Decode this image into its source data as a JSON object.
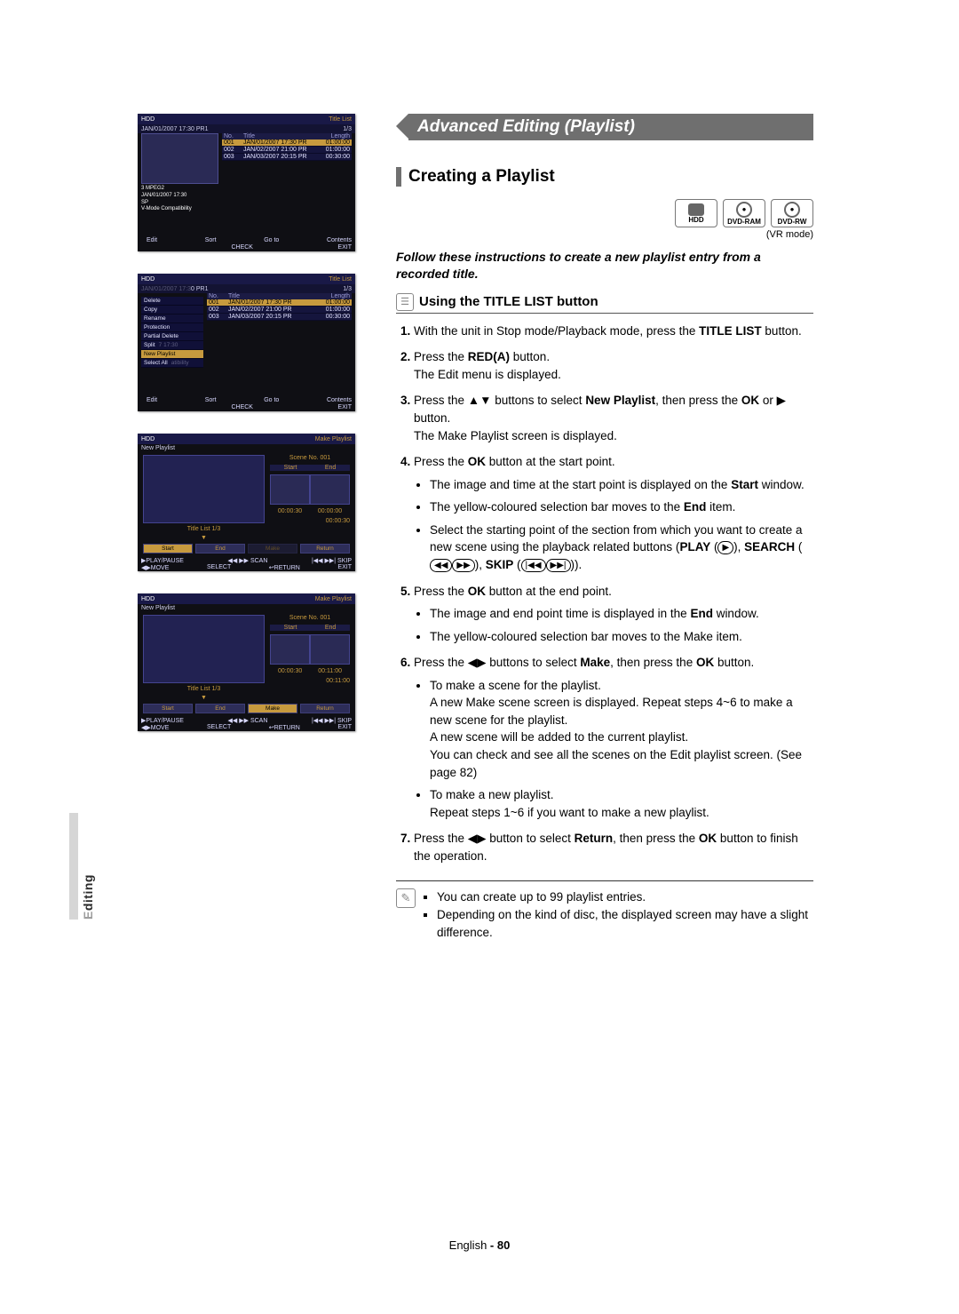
{
  "section_tab": "E<span class='hl'>diting</span>",
  "page_footer": {
    "lang": "English",
    "sep": " - ",
    "num": "80"
  },
  "banner": "Advanced Editing (Playlist)",
  "subheading": "Creating a Playlist",
  "discs": {
    "hdd": "HDD",
    "ram": "DVD-RAM",
    "rw": "DVD-RW"
  },
  "vr_mode": "(VR mode)",
  "lede": "Follow these instructions to create a new playlist entry from a recorded title.",
  "h3": "Using the TITLE LIST button",
  "steps": {
    "s1a": "With the unit in Stop mode/Playback mode, press the ",
    "s1b": "TITLE LIST",
    "s1c": " button.",
    "s2a": "Press the ",
    "s2b": "RED(A)",
    "s2c": " button.",
    "s2d": "The Edit menu is displayed.",
    "s3a": "Press the ▲▼ buttons to select ",
    "s3b": "New Playlist",
    "s3c": ", then press the ",
    "s3d": "OK",
    "s3e": " or ▶ button.",
    "s3f": "The Make Playlist screen is displayed.",
    "s4a": "Press the ",
    "s4b": "OK",
    "s4c": " button at the start point.",
    "s4_b1a": "The image and time at the start point is displayed on the ",
    "s4_b1b": "Start",
    "s4_b1c": " window.",
    "s4_b2a": "The yellow-coloured selection bar moves to the ",
    "s4_b2b": "End",
    "s4_b2c": " item.",
    "s4_b3a": "Select the starting point of the section from which you want to create a new scene using the playback related  buttons (",
    "s4_b3_play": "PLAY",
    "s4_b3b": " (",
    "s4_b3c": "), ",
    "s4_b3_search": "SEARCH",
    "s4_b3d": " (",
    "s4_b3e": "), ",
    "s4_b3_skip": "SKIP",
    "s4_b3f": " (",
    "s4_b3g": ")).",
    "s5a": "Press the ",
    "s5b": "OK",
    "s5c": " button at the end point.",
    "s5_b1a": "The image and end point time is displayed in the ",
    "s5_b1b": "End",
    "s5_b1c": " window.",
    "s5_b2": "The yellow-coloured selection bar moves to the Make item.",
    "s6a": "Press the ◀▶ buttons to select ",
    "s6b": "Make",
    "s6c": ", then press the ",
    "s6d": "OK",
    "s6e": " button.",
    "s6_b1a": "To make a scene for the playlist.",
    "s6_b1b": "A new Make scene screen is displayed. Repeat steps 4~6 to make a new scene for the playlist.",
    "s6_b1c": "A new scene will be added to the current playlist.",
    "s6_b1d": "You can check and see all the scenes on the Edit playlist screen. (See page 82)",
    "s6_b2a": "To make a new playlist.",
    "s6_b2b": "Repeat steps 1~6 if you want to make a new playlist.",
    "s7a": "Press the ◀▶ button to select ",
    "s7b": "Return",
    "s7c": ", then press the ",
    "s7d": "OK",
    "s7e": " button to finish the operation."
  },
  "notes": {
    "n1": "You can create up to 99 playlist entries.",
    "n2": "Depending on the kind of disc, the displayed screen may have a slight difference."
  },
  "shot_common": {
    "hdd": "HDD",
    "titlelist": "Title List",
    "makeplaylist": "Make Playlist",
    "newplaylist": "New Playlist",
    "cols": {
      "no": "No.",
      "title": "Title",
      "length": "Length"
    },
    "count": "1/3",
    "rows": [
      {
        "no": "001",
        "title": "JAN/01/2007 17:30 PR",
        "len": "01:00:00"
      },
      {
        "no": "002",
        "title": "JAN/02/2007 21:00 PR",
        "len": "01:00:00"
      },
      {
        "no": "003",
        "title": "JAN/03/2007 20:15 PR",
        "len": "00:30:00"
      }
    ],
    "bar": {
      "edit": "Edit",
      "sort": "Sort",
      "goto": "Go to",
      "contents": "Contents",
      "check": "CHECK",
      "exit": "EXIT",
      "play": "PLAY/PAUSE",
      "scan": "SCAN",
      "skip": "SKIP",
      "move": "MOVE",
      "select": "SELECT",
      "return": "RETURN"
    }
  },
  "shot1": {
    "subtitle": "JAN/01/2007 17:30 PR1",
    "info": [
      "3 MPEG2",
      "JAN/01/2007 17:30",
      "SP",
      "V-Mode Compatibility"
    ]
  },
  "shot2": {
    "subtitle_suffix": "0 PR1",
    "menu": [
      "Delete",
      "Copy",
      "Rename",
      "Protection",
      "Partial Delete",
      "Split",
      "New Playlist",
      "Select All"
    ],
    "menu_trail": {
      "5": "7 17:30",
      "7": "atibility"
    }
  },
  "shot3": {
    "scene": "Scene No. 001",
    "start": "Start",
    "end": "End",
    "titletag": "Title List  1/3",
    "t1": "00:00:30",
    "t2": "00:00:00",
    "tcur": "00:00:30",
    "btns": [
      "Start",
      "End",
      "Make",
      "Return"
    ],
    "sel": "Start"
  },
  "shot4": {
    "scene": "Scene No. 001",
    "start": "Start",
    "end": "End",
    "titletag": "Title List  1/3",
    "t1": "00:00:30",
    "t2": "00:11:00",
    "tcur": "00:11:00",
    "btns": [
      "Start",
      "End",
      "Make",
      "Return"
    ],
    "sel": "Make"
  }
}
